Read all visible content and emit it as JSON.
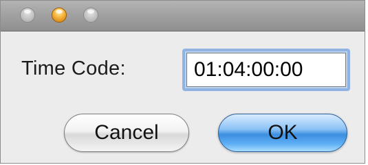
{
  "window": {
    "traffic_lights": [
      {
        "name": "close",
        "color": "#b9b9b9"
      },
      {
        "name": "minimize",
        "color": "#f0a020"
      },
      {
        "name": "zoom",
        "color": "#b9b9b9"
      }
    ]
  },
  "form": {
    "label": "Time Code:",
    "value": "01:04:00:00"
  },
  "buttons": {
    "cancel_label": "Cancel",
    "ok_label": "OK"
  },
  "colors": {
    "accent": "#3d8ee0",
    "focus_ring": "#8fb4e4"
  }
}
